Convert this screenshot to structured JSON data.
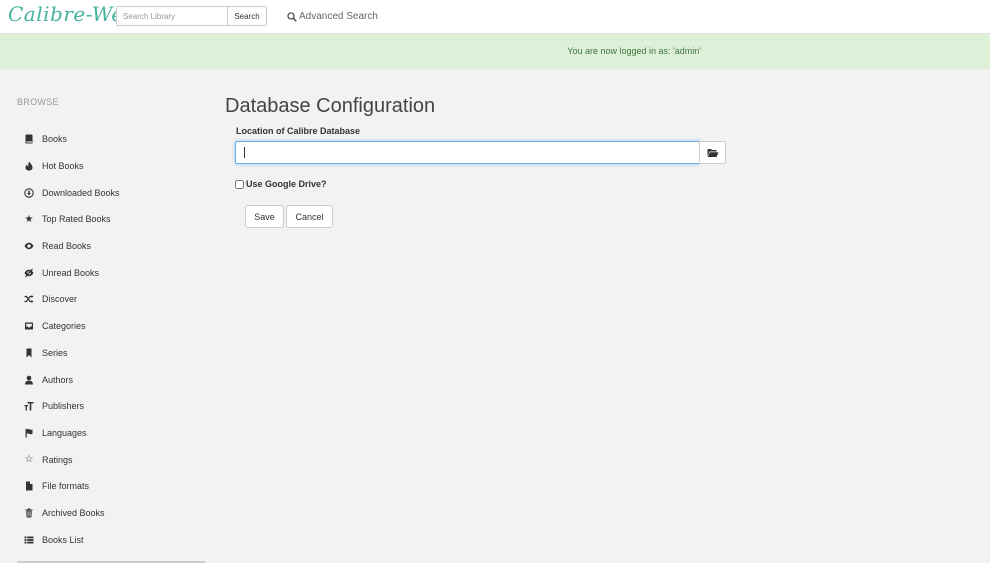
{
  "navbar": {
    "brand": "Calibre-Web",
    "search_placeholder": "Search Library",
    "search_button": "Search",
    "advanced_search": "Advanced Search"
  },
  "flash": {
    "message": "You are now logged in as: 'admin'",
    "color": "#dff0d8"
  },
  "sidebar": {
    "heading": "BROWSE",
    "items": [
      {
        "label": "Books",
        "icon": "book-icon"
      },
      {
        "label": "Hot Books",
        "icon": "fire-icon"
      },
      {
        "label": "Downloaded Books",
        "icon": "download-circle-icon"
      },
      {
        "label": "Top Rated Books",
        "icon": "star-icon"
      },
      {
        "label": "Read Books",
        "icon": "eye-icon"
      },
      {
        "label": "Unread Books",
        "icon": "eye-slash-icon"
      },
      {
        "label": "Discover",
        "icon": "shuffle-icon"
      },
      {
        "label": "Categories",
        "icon": "inbox-icon"
      },
      {
        "label": "Series",
        "icon": "bookmark-icon"
      },
      {
        "label": "Authors",
        "icon": "user-icon"
      },
      {
        "label": "Publishers",
        "icon": "text-size-icon"
      },
      {
        "label": "Languages",
        "icon": "flag-icon"
      },
      {
        "label": "Ratings",
        "icon": "star-outline-icon"
      },
      {
        "label": "File formats",
        "icon": "file-icon"
      },
      {
        "label": "Archived Books",
        "icon": "trash-icon"
      },
      {
        "label": "Books List",
        "icon": "list-icon"
      }
    ]
  },
  "main": {
    "title": "Database Configuration",
    "location_label": "Location of Calibre Database",
    "location_value": "",
    "google_drive_label": "Use Google Drive?",
    "google_drive_checked": false,
    "save_button": "Save",
    "cancel_button": "Cancel"
  },
  "colors": {
    "accent": "#45b29d",
    "input_focus": "#66afe9",
    "background": "#f2f2f2"
  }
}
